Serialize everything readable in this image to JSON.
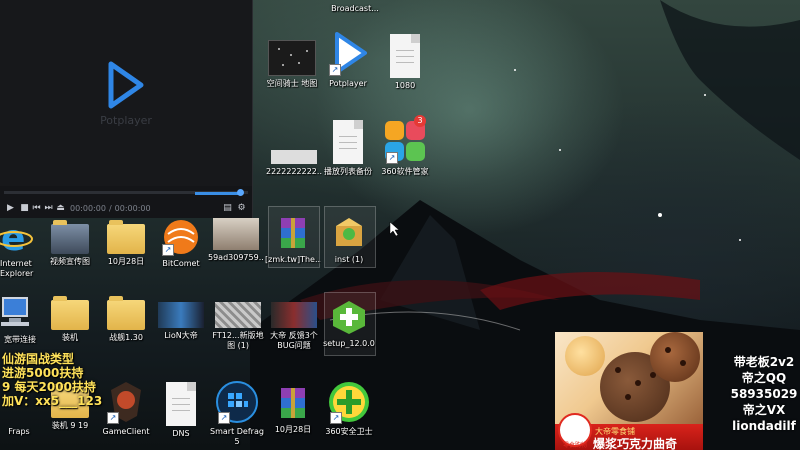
{
  "player": {
    "watermark": "Potplayer",
    "time_current": "00:00:00",
    "time_total": "00:00:00",
    "time_sep": "/",
    "volume_level": 0.95
  },
  "desktop": {
    "icons": [
      {
        "label": "Broadcast...",
        "kind": "app"
      },
      {
        "label": "空间骑士 地图",
        "kind": "image"
      },
      {
        "label": "Potplayer",
        "kind": "potplayer"
      },
      {
        "label": "1080",
        "kind": "doc"
      },
      {
        "label": "2222222222...",
        "kind": "image"
      },
      {
        "label": "播放列表备份",
        "kind": "doc"
      },
      {
        "label": "360软件管家",
        "kind": "app360",
        "badge": "3"
      },
      {
        "label": "Internet Explorer",
        "kind": "ie"
      },
      {
        "label": "视频宣传图",
        "kind": "folder"
      },
      {
        "label": "10月28日",
        "kind": "folder"
      },
      {
        "label": "BitComet",
        "kind": "bitcomet"
      },
      {
        "label": "59ad309759...",
        "kind": "image"
      },
      {
        "label": "[zmk.tw]The...",
        "kind": "rar"
      },
      {
        "label": "inst (1)",
        "kind": "box"
      },
      {
        "label": "宽带连接",
        "kind": "pc"
      },
      {
        "label": "装机",
        "kind": "folder"
      },
      {
        "label": "战舰1.30",
        "kind": "folder"
      },
      {
        "label": "LioN大帝",
        "kind": "image"
      },
      {
        "label": "FT12...新版地图 (1)",
        "kind": "image"
      },
      {
        "label": "大帝 反馈3个BUG问题",
        "kind": "image"
      },
      {
        "label": "setup_12.0.0",
        "kind": "box"
      },
      {
        "label": "Fraps",
        "kind": "app"
      },
      {
        "label": "装机 9 19",
        "kind": "folder"
      },
      {
        "label": "GameClient",
        "kind": "game"
      },
      {
        "label": "DNS",
        "kind": "doc"
      },
      {
        "label": "Smart Defrag 5",
        "kind": "defrag"
      },
      {
        "label": "10月28日",
        "kind": "rar"
      },
      {
        "label": "360安全卫士",
        "kind": "safe360"
      }
    ]
  },
  "overlay": {
    "promo_lines": [
      "仙游国战类型",
      "进游5000扶持",
      "9 每天2000扶持",
      "加V：xx5___123"
    ],
    "contact_lines": [
      "带老板2v2",
      "帝之QQ",
      "58935029",
      "帝之VX",
      "liondadilf"
    ]
  },
  "ad": {
    "small_text": "大帝零食铺",
    "main_text": "爆浆巧克力曲奇",
    "logo_text": "零食购物"
  },
  "colors": {
    "accent_blue": "#3a8ee6",
    "promo_yellow": "#ffe25a",
    "ad_red": "#d9231b"
  }
}
